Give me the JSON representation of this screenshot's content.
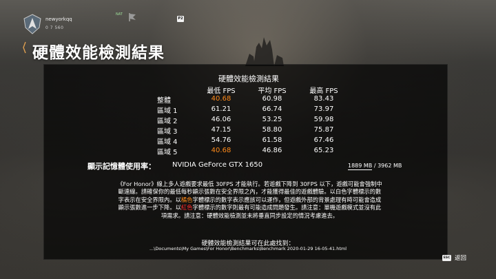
{
  "player": {
    "name": "newyorkqq",
    "stats": "0 7 560",
    "nat_label": "NAT"
  },
  "party_key": "P2",
  "page_title": "硬體效能檢測結果",
  "table": {
    "title": "硬體效能檢測結果",
    "headers": [
      "最低 FPS",
      "平均 FPS",
      "最高 FPS"
    ],
    "rows": [
      {
        "label": "整體",
        "min": "40.68",
        "avg": "60.98",
        "max": "83.43"
      },
      {
        "label": "區域 1",
        "min": "61.21",
        "avg": "66.74",
        "max": "73.97"
      },
      {
        "label": "區域 2",
        "min": "46.06",
        "avg": "53.25",
        "max": "59.98"
      },
      {
        "label": "區域 3",
        "min": "47.15",
        "avg": "58.80",
        "max": "75.87"
      },
      {
        "label": "區域 4",
        "min": "54.76",
        "avg": "61.58",
        "max": "67.46"
      },
      {
        "label": "區域 5",
        "min": "40.68",
        "avg": "46.86",
        "max": "65.23"
      }
    ]
  },
  "vram": {
    "label": "顯示記憶體使用率：",
    "gpu": "NVIDIA GeForce GTX 1650",
    "used": "1889 MB",
    "separator": " / ",
    "total": "3962 MB"
  },
  "notice": {
    "part1": "《For Honor》線上多人遊戲要求最低 30FPS 才能執行。若遊戲下降到 30FPS 以下，遊戲可能會強制中斷連線。請確保你的最低每秒顯示張數在安全界限之內，才能獲得最佳的遊戲體驗。以白色字體標示的數字表示在安全界限內。以",
    "orange_word": "橘色",
    "part2": "字體標示的數字表示應該可以運作，但遊戲外部的背景處理有時可能會造成顯示張數進一步下降。以",
    "red_word": "紅色",
    "part3": "字體標示的數字則最有可能造成問題發生。請注意：單機遊戲模式並沒有此項需求。請注意：硬體效能檢測並未將垂直同步設定的情況考慮進去。"
  },
  "result": {
    "label": "硬體效能檢測結果可在此處找到：",
    "path": "...\\Documents\\My Games\\For Honor\\Benchmarks\\Benchmark 2020-01-29 16-05-41.html"
  },
  "footer": {
    "esc_key": "ESC",
    "back_label": "返回"
  },
  "colors": {
    "warning_orange": "#ff8a1a",
    "danger_red": "#ff2a2a"
  },
  "icons": [
    "faction-emblem-icon",
    "nat-flag-icon",
    "title-marker-icon"
  ]
}
